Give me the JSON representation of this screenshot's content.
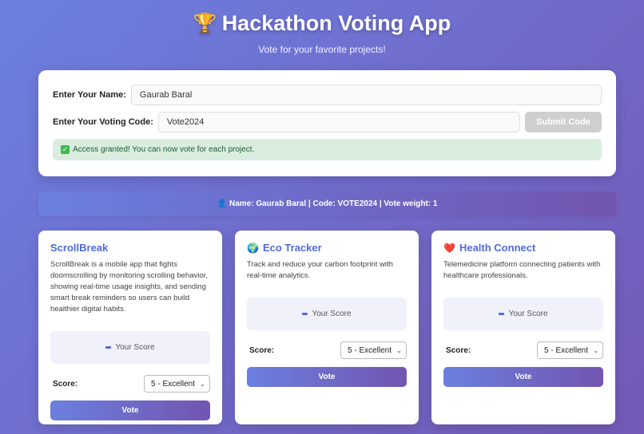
{
  "header": {
    "title": "Hackathon Voting App",
    "trophy_icon": "🏆",
    "subtitle": "Vote for your favorite projects!"
  },
  "login": {
    "name_label": "Enter Your Name:",
    "name_value": "Gaurab Baral",
    "code_label": "Enter Your Voting Code:",
    "code_value": "Vote2024",
    "submit_label": "Submit Code",
    "success_message": "Access granted! You can now vote for each project."
  },
  "info_bar": {
    "text": "Name: Gaurab Baral | Code: VOTE2024 | Vote weight: 1"
  },
  "projects": [
    {
      "icon": "",
      "title": "ScrollBreak",
      "description": "ScrollBreak is a mobile app that fights doomscrolling by monitoring scrolling behavior, showing real-time usage insights, and sending smart break reminders so users can build healthier digital habits.",
      "score_box": "Your Score",
      "score_label": "Score:",
      "selected": "5 - Excellent",
      "vote_label": "Vote"
    },
    {
      "icon": "🌍",
      "title": "Eco Tracker",
      "description": "Track and reduce your carbon footprint with real-time analytics.",
      "score_box": "Your Score",
      "score_label": "Score:",
      "selected": "5 - Excellent",
      "vote_label": "Vote"
    },
    {
      "icon": "❤️",
      "title": "Health Connect",
      "description": "Telemedicine platform connecting patients with healthcare professionals.",
      "score_box": "Your Score",
      "score_label": "Score:",
      "selected": "5 - Excellent",
      "vote_label": "Vote"
    }
  ],
  "colors": {
    "accent": "#4f6bd6",
    "gradient_start": "#6b7fdf",
    "gradient_end": "#7255b0",
    "success_bg": "#d9eedf"
  }
}
